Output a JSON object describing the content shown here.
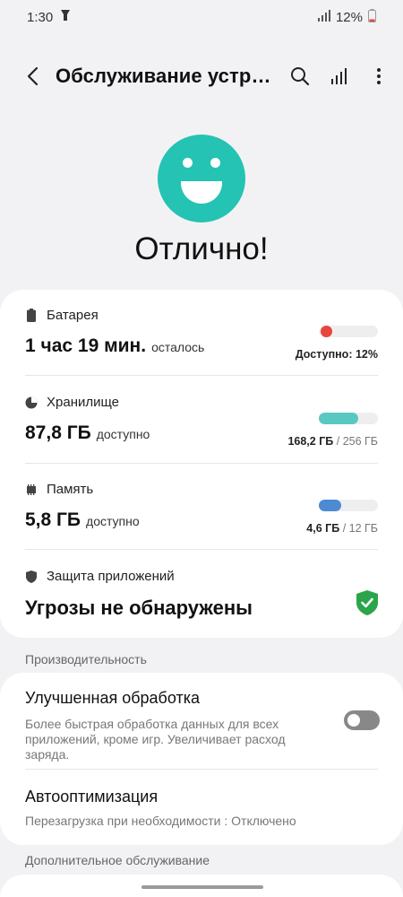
{
  "status_bar": {
    "time": "1:30",
    "battery_text": "12%"
  },
  "app_bar": {
    "title": "Обслуживание устро..."
  },
  "summary": {
    "status_text": "Отлично!"
  },
  "battery": {
    "label": "Батарея",
    "value": "1 час 19 мин.",
    "suffix": "осталось",
    "meta_label": "Доступно:",
    "meta_value": "12%",
    "level": 0.12,
    "color": "#e5463e"
  },
  "storage": {
    "label": "Хранилище",
    "value": "87,8 ГБ",
    "suffix": "доступно",
    "used": "168,2 ГБ",
    "total": "/ 256 ГБ",
    "fill": 0.66,
    "color": "#5ac8c2"
  },
  "memory": {
    "label": "Память",
    "value": "5,8 ГБ",
    "suffix": "доступно",
    "used": "4,6 ГБ",
    "total": "/ 12 ГБ",
    "fill": 0.38,
    "color": "#4d8ad3"
  },
  "protection": {
    "label": "Защита приложений",
    "value": "Угрозы не обнаружены",
    "color": "#2aa54b"
  },
  "sections": {
    "performance": "Производительность",
    "additional": "Дополнительное обслуживание"
  },
  "settings": {
    "enhanced": {
      "title": "Улучшенная обработка",
      "description": "Более быстрая обработка данных для всех приложений, кроме игр. Увеличивает расход заряда.",
      "enabled": false
    },
    "auto_optimize": {
      "title": "Автооптимизация",
      "description": "Перезагрузка при необходимости : Отключено"
    }
  },
  "colors": {
    "accent": "#24c3b4",
    "background": "#f2f2f4"
  }
}
